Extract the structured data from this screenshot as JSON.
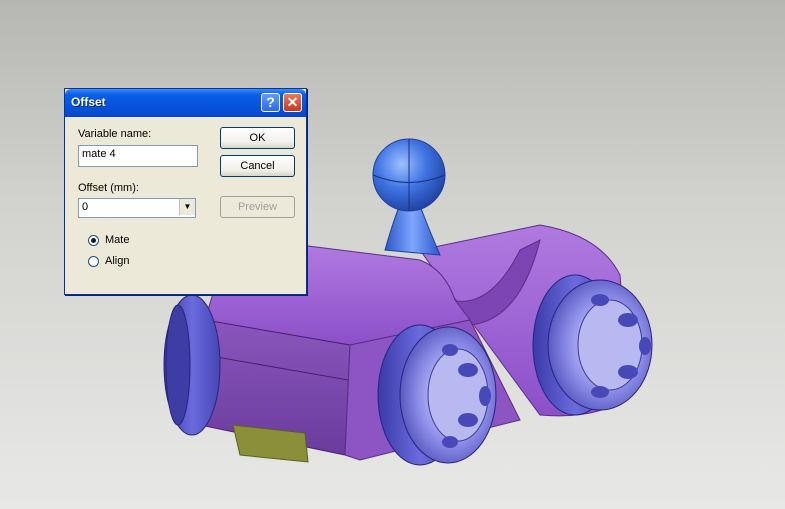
{
  "dialog": {
    "title": "Offset",
    "help_label": "?",
    "close_label": "✕",
    "variable_name_label": "Variable name:",
    "variable_name_value": "mate 4",
    "offset_label": "Offset (mm):",
    "offset_value": "0",
    "ok_label": "OK",
    "cancel_label": "Cancel",
    "preview_label": "Preview",
    "radio_mate_label": "Mate",
    "radio_align_label": "Align",
    "selected_option": "Mate"
  },
  "viewport": {
    "model": "toy car assembly",
    "colors": {
      "body": "#9b5fd0",
      "wheels": "#5a5ad8",
      "figure": "#3d6ee0",
      "panel": "#8a8f3a"
    }
  }
}
